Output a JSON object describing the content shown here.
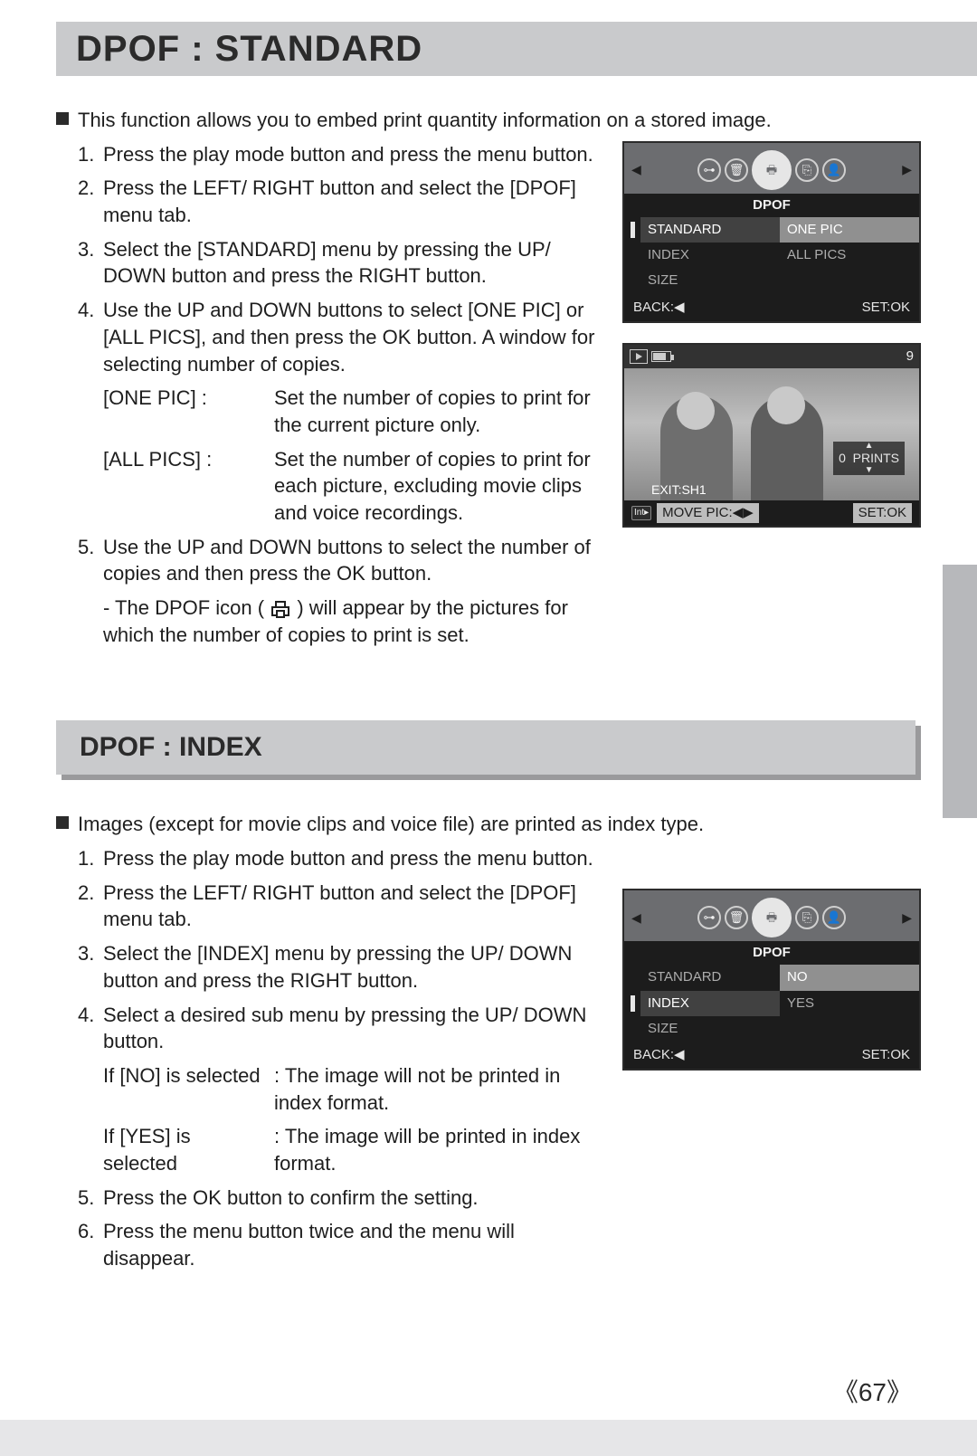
{
  "header": {
    "title": "DPOF : STANDARD"
  },
  "standard": {
    "intro": "This function allows you to embed print quantity information on a stored image.",
    "steps": {
      "s1": "Press the play mode button and press the menu button.",
      "s2": "Press the LEFT/ RIGHT button and select the [DPOF] menu tab.",
      "s3": "Select the [STANDARD] menu by pressing the UP/ DOWN button and press the RIGHT button.",
      "s4": "Use the UP and DOWN buttons to select [ONE PIC] or [ALL PICS], and then press the OK button. A window for selecting number of copies.",
      "onepic_label": "[ONE PIC] :",
      "onepic_desc": "Set the number of copies to print for the current picture only.",
      "allpics_label": "[ALL PICS] :",
      "allpics_desc": "Set the number of copies to print for each picture, excluding movie clips and voice recordings.",
      "s5": "Use the UP and DOWN buttons to select the number of copies and then press the OK button.",
      "note_a": "- The DPOF icon (",
      "note_b": ") will appear by the pictures for which the number of copies to print is set."
    }
  },
  "lcd1": {
    "title": "DPOF",
    "left_items": [
      "STANDARD",
      "INDEX",
      "SIZE"
    ],
    "right_items": [
      "ONE PIC",
      "ALL PICS"
    ],
    "back": "BACK:◀",
    "set": "SET:OK"
  },
  "lcd2": {
    "count": "9",
    "prints_num": "0",
    "prints_label": "PRINTS",
    "exit": "EXIT:SH1",
    "move": "MOVE PIC:◀▶",
    "set": "SET:OK"
  },
  "subheader": {
    "title": "DPOF : INDEX"
  },
  "index": {
    "intro": "Images (except for movie clips and voice file) are printed as index type.",
    "steps": {
      "s1": "Press the play mode button and press the menu button.",
      "s2": "Press the LEFT/ RIGHT button and select the [DPOF] menu tab.",
      "s3": "Select the [INDEX] menu by pressing the UP/ DOWN button and press the RIGHT button.",
      "s4": "Select a desired sub menu by pressing the UP/ DOWN button.",
      "no_label": "If [NO] is selected",
      "no_desc": ": The image will  not be printed in index format.",
      "yes_label": "If [YES] is selected",
      "yes_desc": ": The image will be printed in index format.",
      "s5": "Press the OK button to confirm the setting.",
      "s6": "Press the menu button twice and the menu will disappear."
    }
  },
  "lcd3": {
    "title": "DPOF",
    "left_items": [
      "STANDARD",
      "INDEX",
      "SIZE"
    ],
    "right_items": [
      "NO",
      "YES"
    ],
    "back": "BACK:◀",
    "set": "SET:OK"
  },
  "page": {
    "num": "67"
  },
  "nums": {
    "n1": "1.",
    "n2": "2.",
    "n3": "3.",
    "n4": "4.",
    "n5": "5.",
    "n6": "6."
  }
}
